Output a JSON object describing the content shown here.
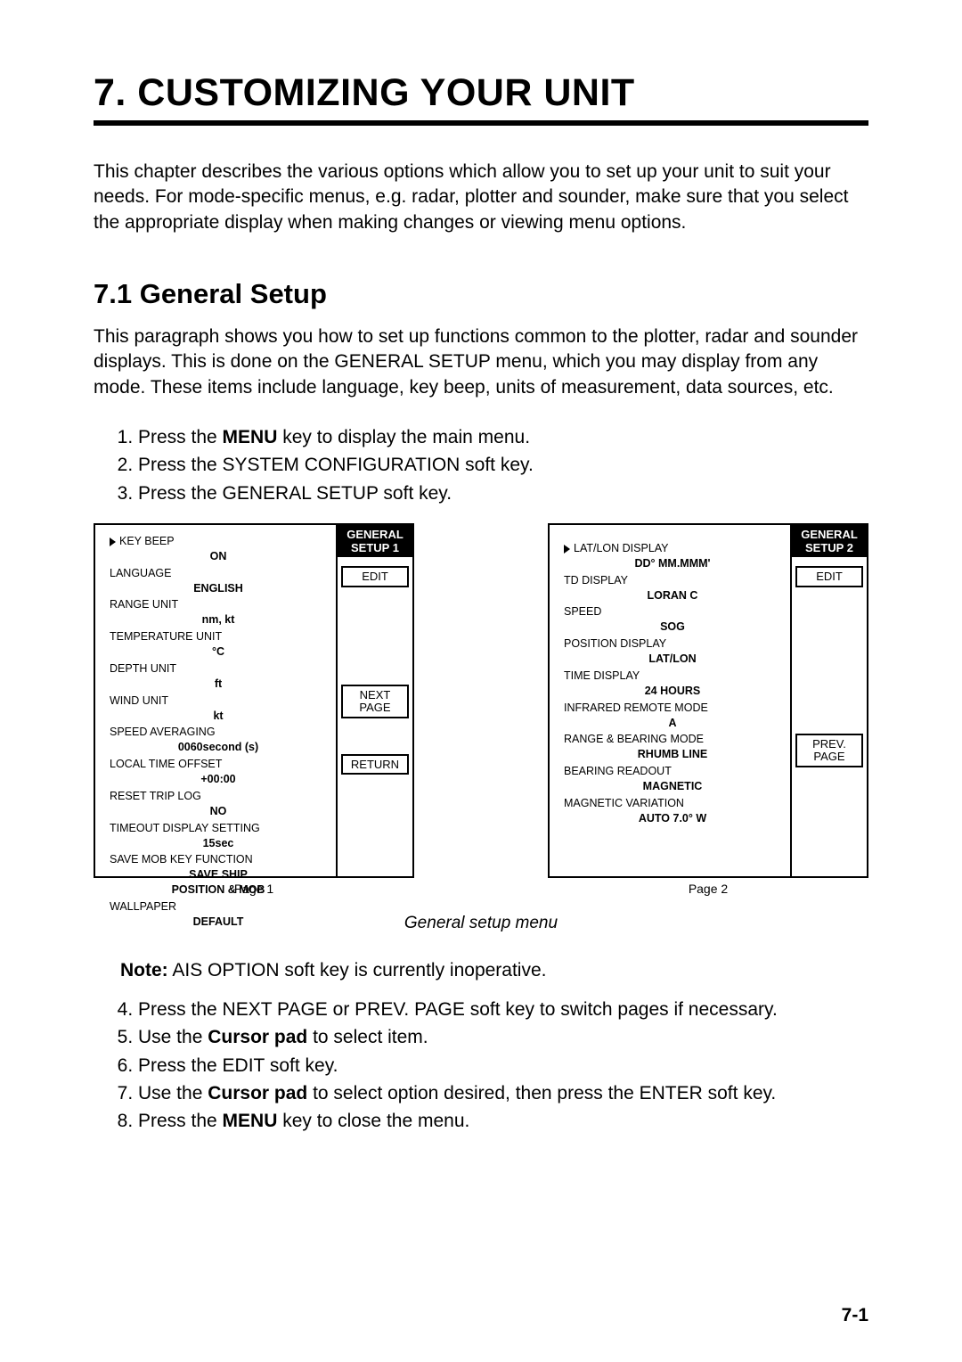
{
  "chapter_title": "7.   CUSTOMIZING YOUR UNIT",
  "intro": "This chapter describes the various options which allow you to set up your unit to suit your needs. For mode-specific menus, e.g. radar, plotter and sounder, make sure that you select the appropriate display when making changes or viewing menu options.",
  "section_title": "7.1    General Setup",
  "section_body": "This paragraph shows you how to set up functions common to the plotter, radar and sounder displays. This is done on the GENERAL SETUP menu, which you may display from any mode. These items include language, key beep, units of measurement, data sources, etc.",
  "steps_a": [
    {
      "pre": "Press the ",
      "bold": "MENU",
      "post": " key to display the main menu."
    },
    {
      "pre": "Press the SYSTEM CONFIGURATION soft key.",
      "bold": "",
      "post": ""
    },
    {
      "pre": "Press the GENERAL SETUP soft key.",
      "bold": "",
      "post": ""
    }
  ],
  "panel1": {
    "header": "GENERAL SETUP 1",
    "softkeys": [
      "EDIT",
      "NEXT PAGE",
      "RETURN"
    ],
    "items": [
      {
        "label": "KEY BEEP",
        "value": "ON",
        "selected": true
      },
      {
        "label": "LANGUAGE",
        "value": "ENGLISH"
      },
      {
        "label": "RANGE UNIT",
        "value": "nm, kt"
      },
      {
        "label": "TEMPERATURE UNIT",
        "value": "°C"
      },
      {
        "label": "DEPTH UNIT",
        "value": "ft"
      },
      {
        "label": "WIND UNIT",
        "value": "kt"
      },
      {
        "label": "SPEED AVERAGING",
        "value": "0060second (s)"
      },
      {
        "label": "LOCAL TIME OFFSET",
        "value": "+00:00"
      },
      {
        "label": "RESET TRIP LOG",
        "value": "NO"
      },
      {
        "label": "TIMEOUT DISPLAY SETTING",
        "value": "15sec"
      },
      {
        "label": "SAVE MOB KEY FUNCTION",
        "value": "SAVE SHIP",
        "value2": "POSITION & MOB"
      },
      {
        "label": "WALLPAPER",
        "value": "DEFAULT"
      }
    ],
    "caption": "Page 1"
  },
  "panel2": {
    "header": "GENERAL SETUP 2",
    "softkeys": [
      "EDIT",
      "PREV. PAGE"
    ],
    "items": [
      {
        "label": "LAT/LON DISPLAY",
        "value": "DD° MM.MMM'",
        "selected": true
      },
      {
        "label": "TD DISPLAY",
        "value": "LORAN C"
      },
      {
        "label": "SPEED",
        "value": "SOG"
      },
      {
        "label": "POSITION DISPLAY",
        "value": "LAT/LON"
      },
      {
        "label": "TIME DISPLAY",
        "value": "24 HOURS"
      },
      {
        "label": "INFRARED REMOTE MODE",
        "value": "A"
      },
      {
        "label": "RANGE & BEARING MODE",
        "value": "RHUMB LINE"
      },
      {
        "label": "BEARING READOUT",
        "value": "MAGNETIC"
      },
      {
        "label": "MAGNETIC VARIATION",
        "value": "AUTO   7.0° W"
      }
    ],
    "caption": "Page 2"
  },
  "figure_caption": "General setup menu",
  "note_bold": "Note:",
  "note_rest": " AIS OPTION soft key is currently inoperative.",
  "steps_b": [
    {
      "n": "4.",
      "pre": "Press the NEXT PAGE or PREV. PAGE soft key to switch pages if necessary.",
      "bold": "",
      "post": ""
    },
    {
      "n": "5.",
      "pre": "Use the ",
      "bold": "Cursor pad",
      "post": " to select item."
    },
    {
      "n": "6.",
      "pre": "Press the EDIT soft key.",
      "bold": "",
      "post": ""
    },
    {
      "n": "7.",
      "pre": "Use the ",
      "bold": "Cursor pad",
      "post": " to select option desired, then press the ENTER soft key."
    },
    {
      "n": "8.",
      "pre": "Press the ",
      "bold": "MENU",
      "post": " key to close the menu."
    }
  ],
  "page_number": "7-1"
}
